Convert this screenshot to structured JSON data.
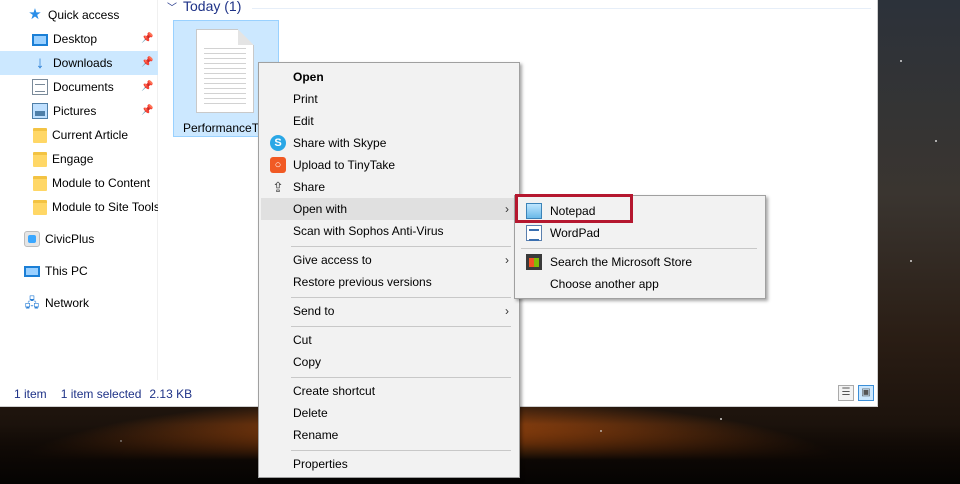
{
  "sidebar": {
    "items": [
      {
        "label": "Quick access",
        "icon": "star-icon"
      },
      {
        "label": "Desktop",
        "icon": "desktop-icon",
        "pinned": true
      },
      {
        "label": "Downloads",
        "icon": "download-icon",
        "pinned": true,
        "selected": true
      },
      {
        "label": "Documents",
        "icon": "documents-icon",
        "pinned": true
      },
      {
        "label": "Pictures",
        "icon": "pictures-icon",
        "pinned": true
      },
      {
        "label": "Current Article",
        "icon": "folder-icon"
      },
      {
        "label": "Engage",
        "icon": "folder-icon"
      },
      {
        "label": "Module to Content",
        "icon": "folder-icon"
      },
      {
        "label": "Module to Site Tools",
        "icon": "folder-icon"
      },
      {
        "label": "CivicPlus",
        "icon": "cloud-icon"
      },
      {
        "label": "This PC",
        "icon": "computer-icon"
      },
      {
        "label": "Network",
        "icon": "network-icon"
      }
    ]
  },
  "content": {
    "group_header": "Today (1)",
    "file_name": "PerformanceTest"
  },
  "status": {
    "item_count": "1 item",
    "selected": "1 item selected",
    "size": "2.13 KB"
  },
  "context_menu": {
    "open": "Open",
    "print": "Print",
    "edit": "Edit",
    "share_skype": "Share with Skype",
    "upload_tinytake": "Upload to TinyTake",
    "share": "Share",
    "open_with": "Open with",
    "scan": "Scan with Sophos Anti-Virus",
    "give_access": "Give access to",
    "restore": "Restore previous versions",
    "send_to": "Send to",
    "cut": "Cut",
    "copy": "Copy",
    "create_shortcut": "Create shortcut",
    "delete": "Delete",
    "rename": "Rename",
    "properties": "Properties"
  },
  "submenu": {
    "notepad": "Notepad",
    "wordpad": "WordPad",
    "store": "Search the Microsoft Store",
    "choose": "Choose another app"
  },
  "colors": {
    "selection": "#cce8ff",
    "highlight_box": "#b5172f",
    "link_blue": "#1e3287"
  }
}
